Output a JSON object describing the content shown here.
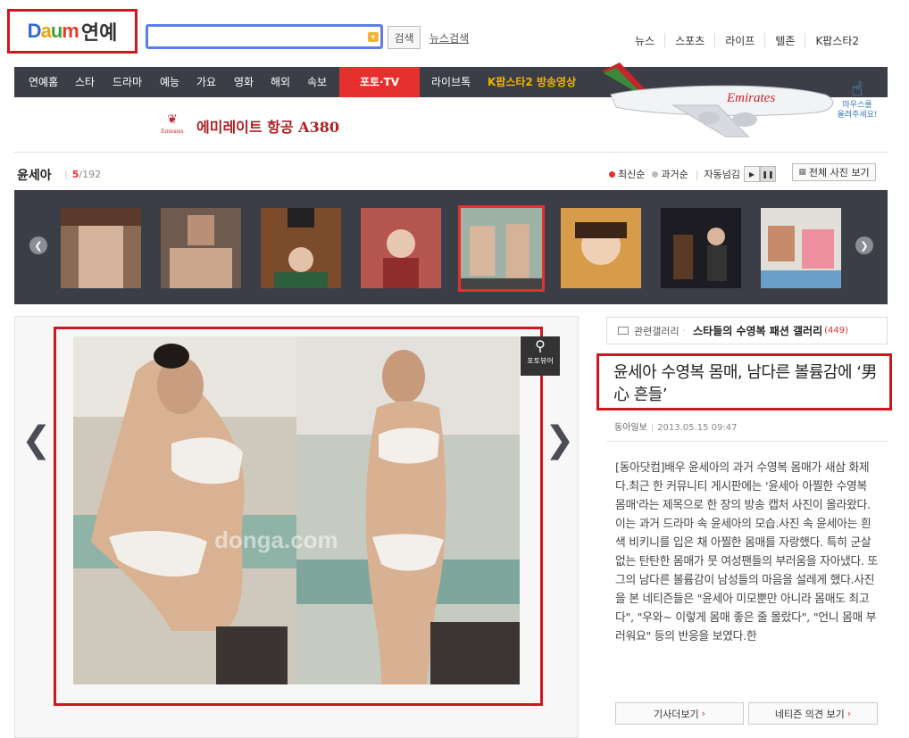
{
  "header": {
    "logo_letters": [
      "D",
      "a",
      "u",
      "m"
    ],
    "logo_section": "연예",
    "search_button": "검색",
    "news_search": "뉴스검색",
    "top_links": [
      "뉴스",
      "스포츠",
      "라이프",
      "텔존",
      "K팝스타2"
    ]
  },
  "nav": {
    "items": [
      "연예홈",
      "스타",
      "드라마",
      "예능",
      "가요",
      "영화",
      "해외",
      "속보"
    ],
    "photo_tv": "포토·TV",
    "live": "라이브톡",
    "kpop": "K팝스타2 방송영상"
  },
  "ad": {
    "brand_small": "Emirates",
    "text": "에미레이트 항공 A380",
    "plane_label": "Emirates",
    "mouse_hint_1": "마우스를",
    "mouse_hint_2": "올려주세요!"
  },
  "gallery": {
    "title": "윤세아",
    "current": "5",
    "total": "/192",
    "sort_latest": "최신순",
    "sort_past": "과거순",
    "auto": "자동넘김",
    "view_all": "전체 사진 보기",
    "active_index": 4
  },
  "photo": {
    "watermark": "donga.com",
    "zoom_label": "포토뷰어"
  },
  "article": {
    "related_label": "관련갤러리",
    "related_title": "스타들의 수영복 패션 갤러리",
    "related_count": "(449)",
    "headline": "윤세아 수영복 몸매, 남다른 볼륨감에 ‘男心 흔들’",
    "source": "동아일보",
    "date": "2013.05.15 09:47",
    "body": "[동아닷컴]배우 윤세아의 과거 수영복 몸매가 새삼 화제다.최근 한 커뮤니티 게시판에는 '윤세아 아찔한 수영복 몸매'라는 제목으로 한 장의 방송 캡처 사진이 올라왔다. 이는 과거 드라마 속 윤세아의 모습.사진 속 윤세아는 흰색 비키니를 입은 채 아찔한 몸매를 자랑했다. 특히 군살 없는 탄탄한 몸매가 뭇 여성팬들의 부러움을 자아냈다. 또 그의 남다른 볼륨감이 남성들의 마음을 설레게 했다.사진을 본 네티즌들은 \"윤세아 미모뿐만 아니라 몸매도 최고다\", \"우와~ 이렇게 몸매 좋은 줄 몰랐다\", \"언니 몸매 부러워요\" 등의 반응을 보였다.한",
    "btn_more": "기사더보기",
    "btn_comments": "네티즌 의견 보기"
  },
  "colors": {
    "accent_red": "#e5302d",
    "nav_bg": "#3b3e46",
    "search_border": "#5a7ee8"
  }
}
